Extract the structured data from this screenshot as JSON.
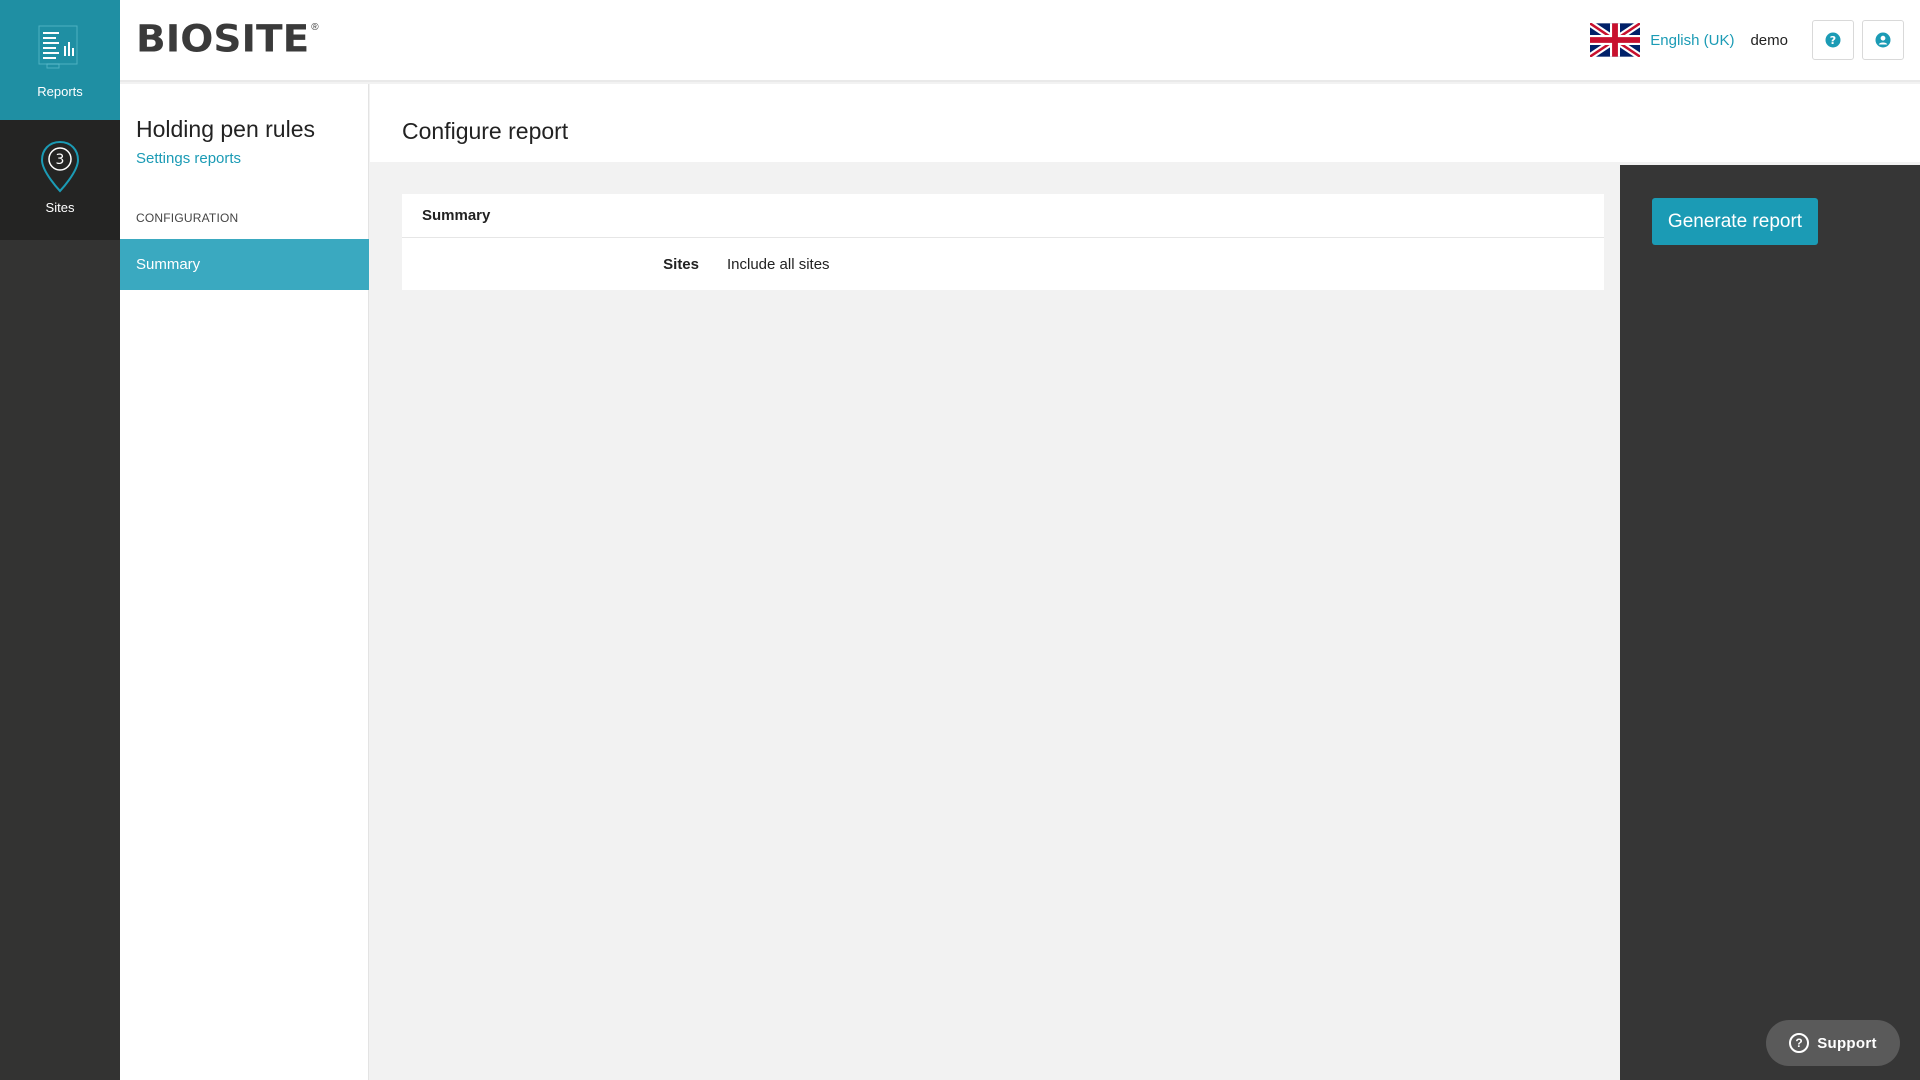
{
  "rail": {
    "reports_label": "Reports",
    "reports_icon": "reports-chart-icon",
    "sites_label": "Sites",
    "sites_icon": "map-pin-icon",
    "sites_count": "3"
  },
  "header": {
    "logo_text": "BIOSITE",
    "logo_mark": "®",
    "language": "English (UK)",
    "flag_icon": "uk-flag-icon",
    "username": "demo",
    "help_icon": "help-icon",
    "user_icon": "user-icon"
  },
  "sidebar": {
    "title": "Holding pen rules",
    "subtitle": "Settings reports",
    "section": "CONFIGURATION",
    "items": [
      {
        "label": "Summary",
        "active": true
      }
    ]
  },
  "main": {
    "title": "Configure report",
    "summary": {
      "heading": "Summary",
      "rows": [
        {
          "label": "Sites",
          "value": "Include all sites"
        }
      ]
    }
  },
  "actions": {
    "generate_label": "Generate report"
  },
  "support": {
    "label": "Support",
    "icon_glyph": "?"
  },
  "colors": {
    "accent": "#1b9bb5",
    "rail_active": "#1f8fa3",
    "sidebar_active": "#3aa9c0",
    "dark_panel": "#363636"
  }
}
